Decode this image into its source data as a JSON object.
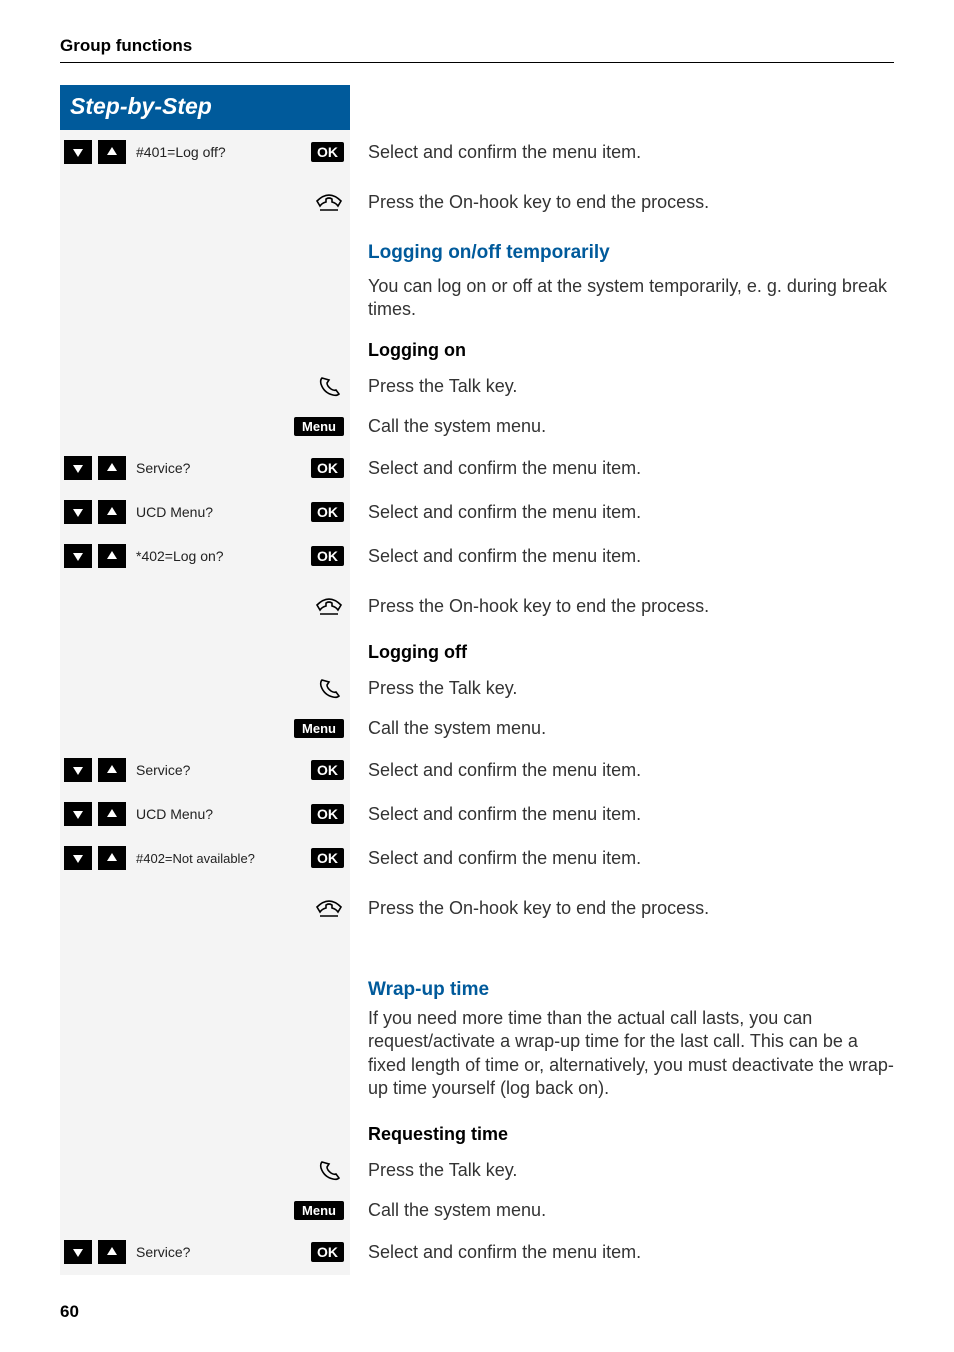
{
  "header": {
    "section": "Group functions"
  },
  "sbs_title": "Step-by-Step",
  "labels": {
    "ok": "OK",
    "menu": "Menu"
  },
  "rows": {
    "r1_menu": "#401=Log off?",
    "r1_desc": "Select and confirm the menu item.",
    "r2_desc": "Press the On-hook key to end the process.",
    "h1": "Logging on/off temporarily",
    "p1": "You can log on or off at the system temporarily, e. g. during break times.",
    "h2": "Logging on",
    "r3_desc": "Press the Talk key.",
    "r4_desc": "Call the system menu.",
    "r5_menu": "Service?",
    "r5_desc": "Select and confirm the menu item.",
    "r6_menu": "UCD Menu?",
    "r6_desc": "Select and confirm the menu item.",
    "r7_menu": "*402=Log on?",
    "r7_desc": "Select and confirm the menu item.",
    "r8_desc": "Press the On-hook key to end the process.",
    "h3": "Logging off",
    "r9_desc": "Press the Talk key.",
    "r10_desc": "Call the system menu.",
    "r11_menu": "Service?",
    "r11_desc": "Select and confirm the menu item.",
    "r12_menu": "UCD Menu?",
    "r12_desc": "Select and confirm the menu item.",
    "r13_menu": "#402=Not available?",
    "r13_desc": "Select and confirm the menu item.",
    "r14_desc": "Press the On-hook key to end the process.",
    "h4": "Wrap-up time",
    "p2": "If you need more time than the actual call lasts, you can request/activate a wrap-up time for the last call. This can be a fixed length of time or, alternatively, you must deactivate the wrap-up time yourself (log back on).",
    "h5": "Requesting time",
    "r15_desc": "Press the Talk key.",
    "r16_desc": "Call the system menu.",
    "r17_menu": "Service?",
    "r17_desc": "Select and confirm the menu item."
  },
  "page_number": "60"
}
